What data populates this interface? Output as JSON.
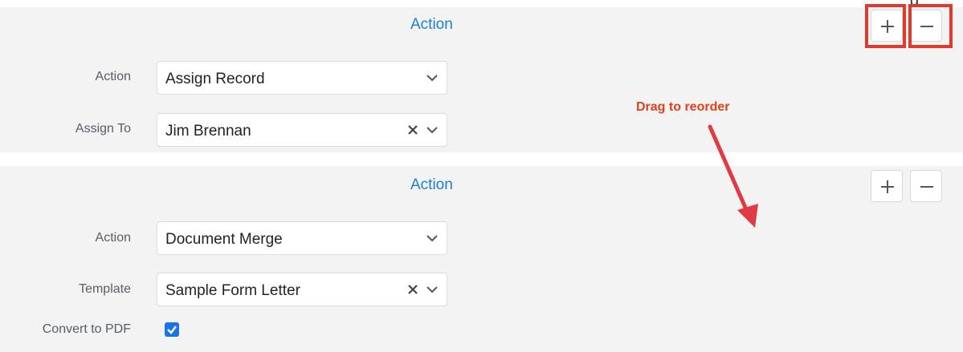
{
  "annotation": {
    "drag_hint": "Drag to reorder"
  },
  "top_fragment": "g",
  "actions": [
    {
      "title": "Action",
      "fields": [
        {
          "label": "Action",
          "value": "Assign Record"
        },
        {
          "label": "Assign To",
          "value": "Jim Brennan"
        }
      ]
    },
    {
      "title": "Action",
      "fields": [
        {
          "label": "Action",
          "value": "Document Merge"
        },
        {
          "label": "Template",
          "value": "Sample Form Letter"
        }
      ],
      "checkbox": {
        "label": "Convert to PDF",
        "checked": true
      }
    }
  ],
  "colors": {
    "accent_blue": "#1e7fd0",
    "highlight_red": "#e03a2c",
    "annotation_red": "#e2401c",
    "checkbox_blue": "#1a73e8"
  },
  "icons": [
    "plus-icon",
    "minus-icon",
    "chevron-down-icon",
    "clear-icon",
    "check-icon",
    "arrow-icon"
  ]
}
